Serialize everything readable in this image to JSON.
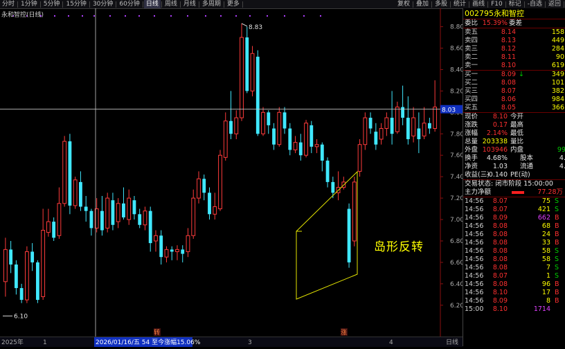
{
  "toolbar": {
    "items": [
      "分时",
      "1分钟",
      "5分钟",
      "15分钟",
      "30分钟",
      "60分钟",
      "日线",
      "周线",
      "月线",
      "多周期",
      "更多"
    ],
    "active": "日线",
    "right_items": [
      "复权",
      "叠加",
      "多股",
      "统计",
      "画线",
      "F10",
      "标记",
      "-自选",
      "返回"
    ]
  },
  "chart_title": "永和智控(日线)",
  "price_axis": [
    "8.80",
    "8.60",
    "8.40",
    "8.20",
    "8.00",
    "7.80",
    "7.60",
    "7.40",
    "7.20",
    "7.00",
    "6.80",
    "6.60",
    "6.40",
    "6.20"
  ],
  "crosshair_price": "8.03",
  "high_label": "8.83",
  "low_label": "6.10",
  "annotation": "岛形反转",
  "bottom_axis": {
    "year": "2025年",
    "m1": "1",
    "m3": "3",
    "m4": "4",
    "period": "日线"
  },
  "status_text": "2026/01/16/五  54  至今涨幅15.06%",
  "markers": {
    "m1": "转",
    "m2": "涨"
  },
  "colors": {
    "up": "#ff3b3b",
    "down": "#40e8ff",
    "cross": "#c8c8c8",
    "box": "#e6e600"
  },
  "chart_data": {
    "type": "candlestick",
    "ylim": [
      6.05,
      8.92
    ],
    "candles": [
      [
        6.42,
        6.72,
        6.28,
        6.83
      ],
      [
        6.72,
        6.58,
        6.5,
        6.8
      ],
      [
        6.58,
        6.36,
        6.3,
        6.62
      ],
      [
        6.36,
        6.25,
        6.22,
        6.4
      ],
      [
        6.25,
        6.7,
        6.22,
        6.75
      ],
      [
        6.7,
        6.6,
        6.52,
        6.78
      ],
      [
        6.6,
        6.25,
        6.22,
        6.62
      ],
      [
        6.28,
        6.9,
        6.25,
        7.1
      ],
      [
        6.88,
        6.98,
        6.84,
        7.1
      ],
      [
        6.98,
        6.83,
        6.8,
        7.02
      ],
      [
        6.85,
        7.15,
        6.82,
        7.3
      ],
      [
        7.15,
        7.73,
        7.12,
        7.78
      ],
      [
        7.73,
        7.13,
        7.05,
        7.8
      ],
      [
        7.13,
        7.37,
        7.1,
        7.4
      ],
      [
        7.35,
        7.12,
        7.08,
        7.45
      ],
      [
        7.12,
        7.08,
        6.98,
        7.22
      ],
      [
        7.08,
        6.92,
        6.85,
        7.1
      ],
      [
        6.92,
        7.1,
        6.88,
        7.2
      ],
      [
        7.08,
        6.9,
        6.85,
        7.22
      ],
      [
        6.92,
        7.2,
        6.88,
        7.25
      ],
      [
        7.18,
        6.95,
        6.9,
        7.25
      ],
      [
        6.98,
        7.15,
        6.92,
        7.2
      ],
      [
        7.15,
        7.02,
        7.0,
        7.3
      ],
      [
        7.0,
        7.2,
        6.95,
        7.28
      ],
      [
        7.18,
        7.05,
        7.0,
        7.22
      ],
      [
        7.05,
        6.95,
        6.92,
        7.1
      ],
      [
        6.95,
        7.08,
        6.9,
        7.12
      ],
      [
        7.08,
        6.78,
        6.7,
        7.12
      ],
      [
        6.8,
        6.85,
        6.7,
        6.9
      ],
      [
        6.85,
        6.65,
        6.58,
        6.9
      ],
      [
        6.65,
        6.72,
        6.6,
        6.75
      ],
      [
        6.72,
        6.7,
        6.62,
        6.75
      ],
      [
        6.7,
        6.72,
        6.62,
        6.76
      ],
      [
        6.72,
        6.68,
        6.6,
        6.76
      ],
      [
        6.7,
        6.85,
        6.65,
        6.92
      ],
      [
        6.85,
        7.2,
        6.82,
        7.28
      ],
      [
        7.2,
        7.38,
        7.15,
        7.45
      ],
      [
        7.38,
        7.25,
        7.18,
        7.42
      ],
      [
        7.25,
        7.05,
        7.0,
        7.3
      ],
      [
        7.05,
        7.12,
        7.0,
        7.25
      ],
      [
        7.1,
        7.6,
        7.08,
        7.65
      ],
      [
        7.58,
        7.92,
        7.55,
        8.0
      ],
      [
        7.92,
        7.8,
        7.75,
        8.2
      ],
      [
        7.8,
        7.95,
        7.75,
        8.02
      ],
      [
        7.95,
        8.7,
        7.92,
        8.83
      ],
      [
        8.7,
        8.2,
        8.18,
        8.8
      ],
      [
        8.2,
        8.55,
        8.15,
        8.62
      ],
      [
        8.52,
        7.8,
        7.78,
        8.58
      ],
      [
        7.8,
        8.0,
        7.78,
        8.05
      ],
      [
        8.0,
        7.88,
        7.8,
        8.02
      ],
      [
        7.85,
        7.7,
        7.65,
        7.9
      ],
      [
        7.7,
        8.0,
        7.68,
        8.05
      ],
      [
        8.0,
        7.85,
        7.8,
        8.05
      ],
      [
        7.85,
        7.65,
        7.6,
        7.9
      ],
      [
        7.65,
        7.72,
        7.62,
        7.78
      ],
      [
        7.72,
        7.6,
        7.55,
        7.8
      ],
      [
        7.6,
        7.9,
        7.58,
        7.93
      ],
      [
        7.88,
        7.68,
        7.62,
        7.92
      ],
      [
        7.68,
        7.7,
        7.62,
        7.75
      ],
      [
        7.7,
        7.55,
        7.45,
        7.72
      ],
      [
        7.55,
        7.35,
        7.3,
        7.58
      ],
      [
        7.35,
        7.25,
        7.2,
        7.4
      ],
      [
        7.25,
        7.3,
        7.18,
        7.45
      ],
      [
        7.3,
        7.35,
        7.28,
        7.4
      ],
      [
        7.1,
        6.6,
        6.55,
        7.15
      ],
      [
        6.8,
        7.35,
        6.75,
        7.4
      ],
      [
        7.45,
        7.7,
        7.4,
        7.75
      ],
      [
        7.7,
        7.95,
        7.65,
        8.0
      ],
      [
        7.95,
        7.85,
        7.8,
        8.0
      ],
      [
        7.82,
        7.7,
        7.65,
        7.9
      ],
      [
        7.75,
        7.85,
        7.7,
        7.9
      ],
      [
        7.85,
        7.95,
        7.78,
        8.0
      ],
      [
        7.95,
        7.8,
        7.7,
        8.2
      ],
      [
        7.82,
        8.05,
        7.8,
        8.1
      ],
      [
        8.05,
        7.95,
        7.88,
        8.25
      ],
      [
        7.95,
        7.75,
        7.7,
        8.15
      ],
      [
        7.78,
        7.95,
        7.72,
        8.05
      ],
      [
        7.85,
        7.75,
        7.62,
        8.0
      ],
      [
        7.78,
        7.9,
        7.75,
        8.05
      ],
      [
        7.9,
        7.85,
        7.8,
        7.95
      ],
      [
        7.85,
        8.05,
        7.82,
        8.3
      ]
    ]
  },
  "quote": {
    "code": "002795",
    "name": "永和智控",
    "webi_label": "委比",
    "webi_value": "15.39%",
    "weicha_label": "委差",
    "asks": [
      {
        "label": "卖五",
        "price": "8.14",
        "vol": "158"
      },
      {
        "label": "卖四",
        "price": "8.13",
        "vol": "449"
      },
      {
        "label": "卖三",
        "price": "8.12",
        "vol": "284"
      },
      {
        "label": "卖二",
        "price": "8.11",
        "vol": "90"
      },
      {
        "label": "卖一",
        "price": "8.10",
        "vol": "619"
      }
    ],
    "bids": [
      {
        "label": "买一",
        "price": "8.09",
        "vol": "349",
        "arrow": "↓"
      },
      {
        "label": "买二",
        "price": "8.08",
        "vol": "101",
        "arrow": ""
      },
      {
        "label": "买三",
        "price": "8.07",
        "vol": "382",
        "arrow": ""
      },
      {
        "label": "买四",
        "price": "8.06",
        "vol": "984",
        "arrow": ""
      },
      {
        "label": "买五",
        "price": "8.05",
        "vol": "366",
        "arrow": ""
      }
    ],
    "stats": {
      "xianjia_label": "现价",
      "xianjia": "8.10",
      "jinkai_label": "今开",
      "zhangdie_label": "涨跌",
      "zhangdie": "0.17",
      "zuigao_label": "最高",
      "zhangfu_label": "涨幅",
      "zhangfu": "2.14%",
      "zuidi_label": "最低",
      "zongliang_label": "总量",
      "zongliang": "203338",
      "liangbi_label": "量比",
      "waipan_label": "外盘",
      "waipan": "103946",
      "neipan_label": "内盘",
      "neipan": "99",
      "huanshou_label": "换手",
      "huanshou": "4.68%",
      "guben_label": "股本",
      "guben": "4.",
      "jingzi_label": "净资",
      "jingzi": "1.03",
      "liutong_label": "流通",
      "liutong": "4.",
      "shouyi_label": "收益(三)",
      "shouyi": "-0.140",
      "pe_label": "PE(动)"
    },
    "trade_status": "交易状态: 闭市阶段 15:00:00",
    "net_inflow_label": "主力净额",
    "net_inflow_value": "77.28万"
  },
  "ticks": [
    {
      "t": "14:56",
      "p": "8.07",
      "v": "75",
      "d": "S"
    },
    {
      "t": "14:56",
      "p": "8.07",
      "v": "421",
      "d": "S"
    },
    {
      "t": "14:56",
      "p": "8.09",
      "v": "662",
      "d": "B"
    },
    {
      "t": "14:56",
      "p": "8.08",
      "v": "68",
      "d": "B"
    },
    {
      "t": "14:56",
      "p": "8.08",
      "v": "24",
      "d": "B"
    },
    {
      "t": "14:56",
      "p": "8.08",
      "v": "33",
      "d": "B"
    },
    {
      "t": "14:56",
      "p": "8.08",
      "v": "58",
      "d": "S"
    },
    {
      "t": "14:56",
      "p": "8.08",
      "v": "58",
      "d": "S"
    },
    {
      "t": "14:56",
      "p": "8.08",
      "v": "7",
      "d": "S"
    },
    {
      "t": "14:56",
      "p": "8.07",
      "v": "1",
      "d": "S"
    },
    {
      "t": "14:56",
      "p": "8.08",
      "v": "96",
      "d": "B"
    },
    {
      "t": "14:56",
      "p": "8.10",
      "v": "17",
      "d": "B"
    },
    {
      "t": "14:56",
      "p": "8.09",
      "v": "8",
      "d": "B"
    },
    {
      "t": "15:00",
      "p": "8.10",
      "v": "1714",
      "d": ""
    }
  ]
}
